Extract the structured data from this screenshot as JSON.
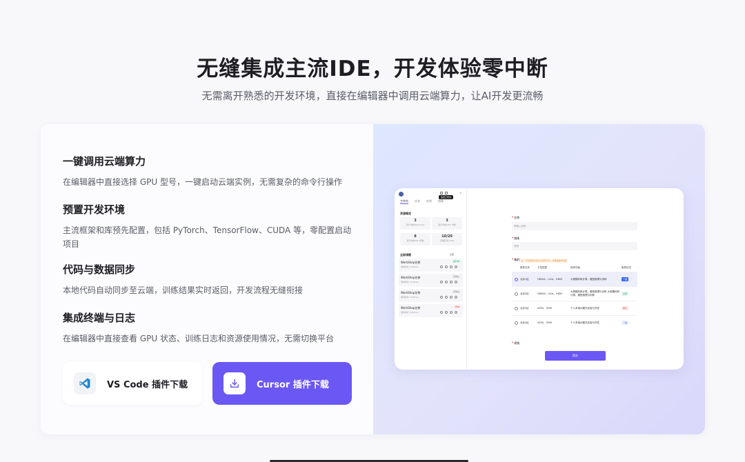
{
  "hero": {
    "title": "无缝集成主流IDE，开发体验零中断",
    "subtitle": "无需离开熟悉的开发环境，直接在编辑器中调用云端算力，让AI开发更流畅"
  },
  "features": [
    {
      "title": "一键调用云端算力",
      "desc": "在编辑器中直接选择 GPU 型号，一键启动云端实例，无需复杂的命令行操作"
    },
    {
      "title": "预置开发环境",
      "desc": "主流框架和库预先配置，包括 PyTorch、TensorFlow、CUDA 等，零配置启动项目"
    },
    {
      "title": "代码与数据同步",
      "desc": "本地代码自动同步至云端，训练结果实时返回，开发流程无缝衔接"
    },
    {
      "title": "集成终端与日志",
      "desc": "在编辑器中直接查看 GPU 状态、训练日志和资源使用情况，无需切换平台"
    }
  ],
  "buttons": {
    "vscode": {
      "label": "VS Code 插件下载",
      "icon": "vscode-icon"
    },
    "cursor": {
      "label": "Cursor 插件下载",
      "icon": "download-icon"
    }
  },
  "colors": {
    "accent": "#6a57f4",
    "title": "#1d1d22",
    "muted": "#5b5d66"
  },
  "mockup": {
    "tabs": [
      "工作台",
      "任务",
      "实例",
      "镜像"
    ],
    "tooltip": "设置工作台",
    "resources_title": "资源概览",
    "resources": [
      {
        "value": "3",
        "label": "运行中的Workshop"
      },
      {
        "value": "3",
        "label": "运行中的GPU 卡数"
      },
      {
        "value": "8",
        "label": "运行中的CPU 核数"
      },
      {
        "value": "10/20",
        "label": "存储空间 (GB)"
      }
    ],
    "projects_title": "全部课题",
    "filter": "全部",
    "projects": [
      {
        "name": "WorkShop名称",
        "meta": "使用时长 2h30min",
        "tag": "运行中",
        "tag_color": "#2fa56a",
        "tag_bg": "#e6f6ee"
      },
      {
        "name": "WorkShop名称",
        "meta": "使用时长 2h30min",
        "tag": "已停止",
        "tag_color": "#777",
        "tag_bg": "#eee"
      },
      {
        "name": "WorkShop名称",
        "meta": "使用时长 2h30min",
        "tag": "已停止",
        "tag_color": "#777",
        "tag_bg": "#eee"
      },
      {
        "name": "WorkShop名称",
        "meta": "使用时长 2h30min",
        "tag": "异常",
        "tag_color": "#e34b4b",
        "tag_bg": "#fdeaea"
      }
    ],
    "form": {
      "name_label": "名称",
      "name_placeholder": "请输入名称",
      "image_label": "镜像",
      "image_value": "请选",
      "cluster_label": "集群",
      "cluster_hint": "注：不同集群可选GPU型号不同，请根据需求选择",
      "headers": [
        "集群名称",
        "卡型配置",
        "推荐场景",
        "集群状态"
      ],
      "rows": [
        {
          "name": "北京1区",
          "gpu": "H800A、L40s、H800",
          "scene": "大规模科研计算、模型推理与训练",
          "status": "一般",
          "status_color": "#ffffff",
          "status_bg": "#3b6ff5",
          "selected": true
        },
        {
          "name": "北京2区",
          "gpu": "H800A、L40s、H800",
          "scene": "大规模科研计算、模型推理与训练 大规模科研计算、模型推理与训练",
          "status": "空闲",
          "status_color": "#2fa56a",
          "status_bg": "#e6f6ee",
          "selected": false
        },
        {
          "name": "北京3区",
          "gpu": "4090、3090",
          "scene": "个人本地AI模式实验与开发",
          "status": "繁忙",
          "status_color": "#e34b4b",
          "status_bg": "#fdeaea",
          "selected": false
        },
        {
          "name": "北京4区",
          "gpu": "4090、3090",
          "scene": "个人本地AI模式实验与开发",
          "status": "一般",
          "status_color": "#3b6ff5",
          "status_bg": "#e8eefd",
          "selected": false
        }
      ],
      "spec_label": "规格",
      "submit": "提交"
    }
  }
}
